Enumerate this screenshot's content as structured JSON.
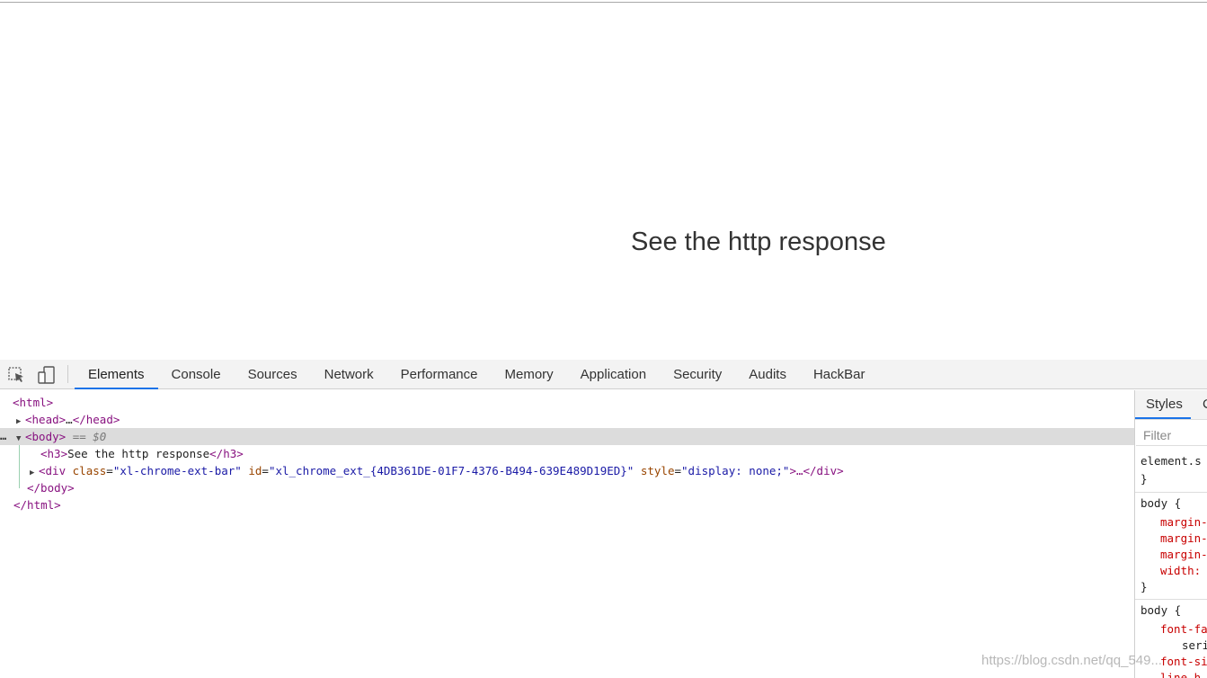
{
  "page": {
    "heading": "See the http response"
  },
  "devtools": {
    "toolbar": {
      "inspect_icon": "element-picker-icon",
      "device_icon": "device-toggle-icon"
    },
    "tabs": [
      "Elements",
      "Console",
      "Sources",
      "Network",
      "Performance",
      "Memory",
      "Application",
      "Security",
      "Audits",
      "HackBar"
    ],
    "active_tab": "Elements",
    "dom_tree": {
      "html_open": "<html>",
      "head_open": "<head>",
      "head_ellipsis": "…",
      "head_close": "</head>",
      "body_open": "<body>",
      "body_marker": "== $0",
      "h3_open": "<h3>",
      "h3_text": "See the http response",
      "h3_close": "</h3>",
      "div_open": "<div",
      "div_class_attr": "class",
      "div_class_val": "\"xl-chrome-ext-bar\"",
      "div_id_attr": "id",
      "div_id_val": "\"xl_chrome_ext_{4DB361DE-01F7-4376-B494-639E489D19ED}\"",
      "div_style_attr": "style",
      "div_style_val": "\"display: none;\"",
      "div_tail": ">…</div>",
      "body_close": "</body>",
      "html_close": "</html>",
      "dots": "…"
    },
    "styles_pane": {
      "tabs": [
        "Styles",
        "C"
      ],
      "filter_placeholder": "Filter",
      "rules": {
        "element_style": "element.s",
        "close_brace": "}",
        "body_selector": "body {",
        "rule1_props": [
          "margin-",
          "margin-",
          "margin-",
          "width:"
        ],
        "rule2_props": [
          "font-fa",
          "seri",
          "font-si",
          "line-h"
        ]
      }
    }
  },
  "watermark": "https://blog.csdn.net/qq_549..."
}
